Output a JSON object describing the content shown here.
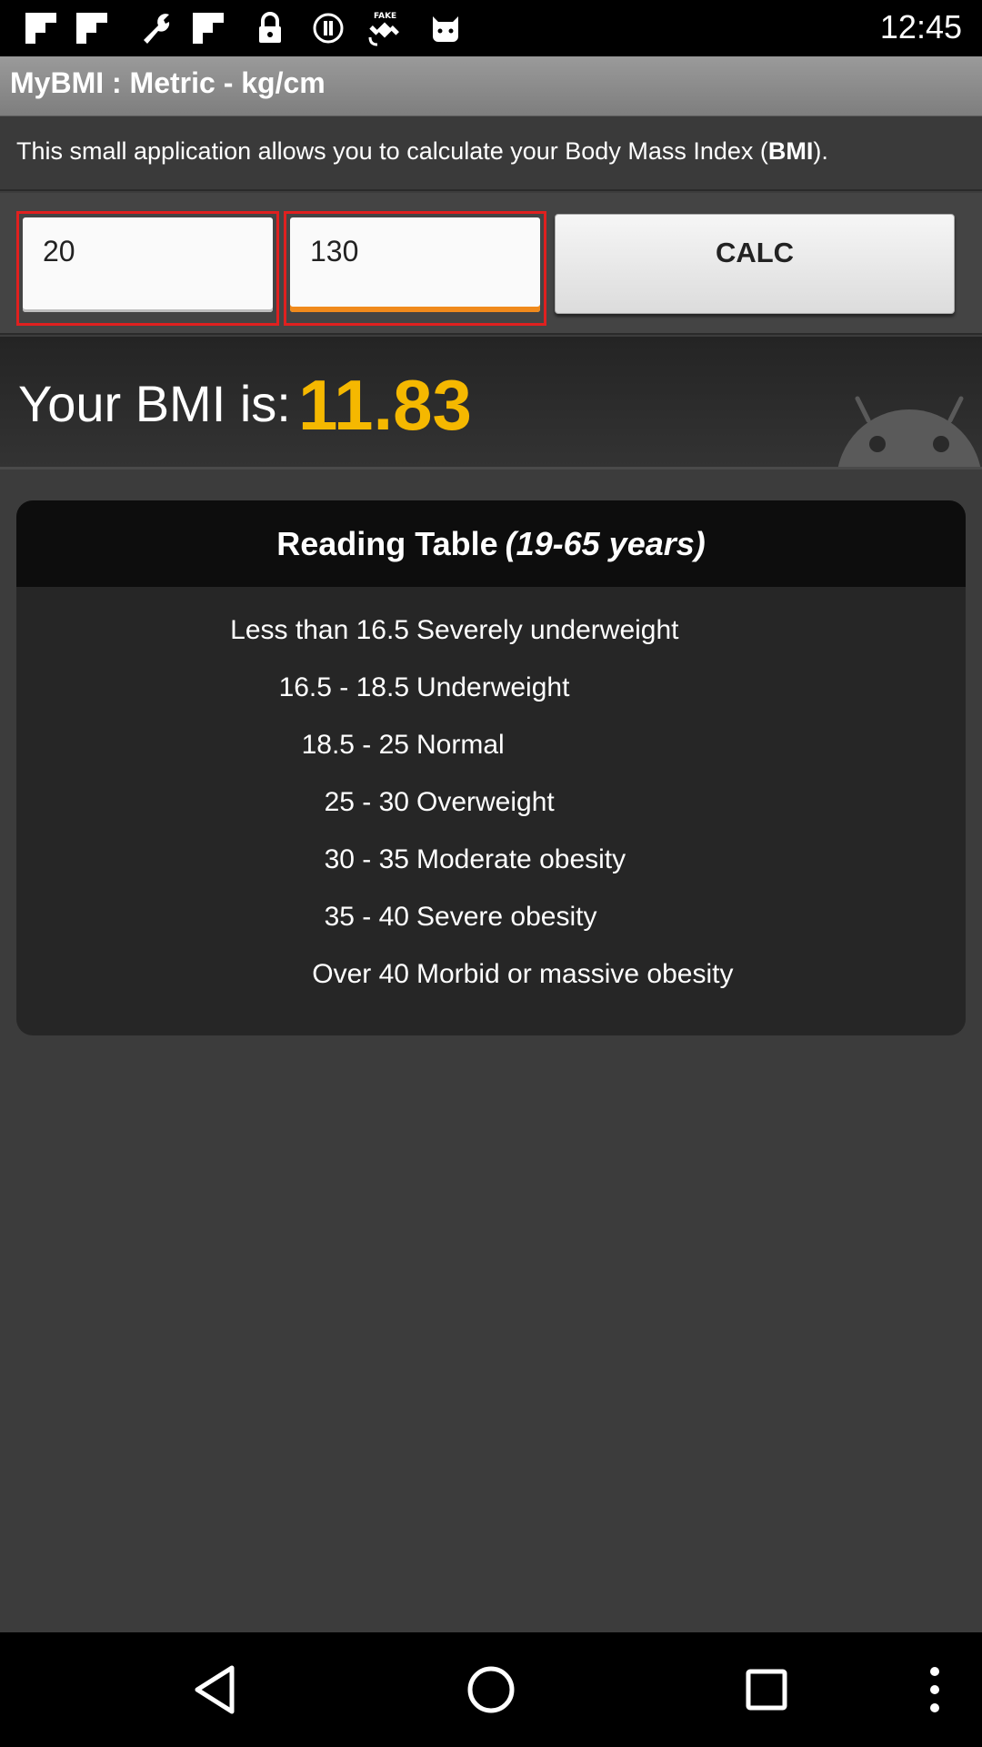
{
  "status_bar": {
    "time": "12:45",
    "icons": [
      "flipboard-icon",
      "flipboard-icon",
      "wrench-icon",
      "flipboard-icon",
      "lock-icon",
      "info-circle-icon",
      "fake-gps-satellite-icon",
      "android-cat-icon"
    ]
  },
  "title_bar": {
    "title": "MyBMI : Metric - kg/cm"
  },
  "intro": {
    "text_before": "This small application allows you to calculate your Body Mass Index (",
    "text_bold": "BMI",
    "text_after": ")."
  },
  "inputs": {
    "weight_value": "20",
    "height_value": "130",
    "calc_label": "CALC"
  },
  "result": {
    "label": "Your BMI is:",
    "value": "11.83"
  },
  "reading_table": {
    "title": "Reading Table",
    "subtitle": "(19-65 years)",
    "rows": [
      {
        "range": "Less than 16.5",
        "category": "Severely underweight"
      },
      {
        "range": "16.5 - 18.5",
        "category": "Underweight"
      },
      {
        "range": "18.5 - 25",
        "category": "Normal"
      },
      {
        "range": "25 - 30",
        "category": "Overweight"
      },
      {
        "range": "30 - 35",
        "category": "Moderate obesity"
      },
      {
        "range": "35 - 40",
        "category": "Severe obesity"
      },
      {
        "range": "Over 40",
        "category": "Morbid or massive obesity"
      }
    ]
  },
  "nav_bar": {
    "icons": [
      "back-icon",
      "home-icon",
      "recents-icon",
      "menu-dots-icon"
    ]
  },
  "colors": {
    "accent": "#f5b800",
    "highlight_border": "#e0201f",
    "focus_underline": "#f08a1c"
  }
}
